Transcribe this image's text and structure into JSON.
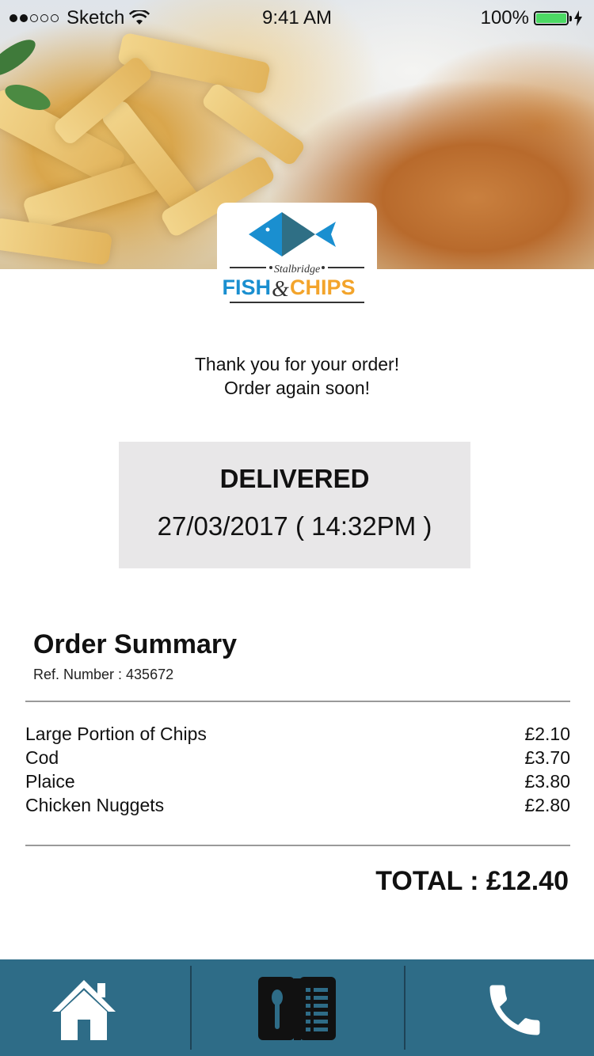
{
  "status_bar": {
    "carrier": "Sketch",
    "time": "9:41 AM",
    "battery": "100%"
  },
  "logo": {
    "script": "Stalbridge",
    "brand_left": "FISH",
    "amp": "&",
    "brand_right": "CHIPS"
  },
  "message": {
    "line1": "Thank you for your order!",
    "line2": "Order again soon!"
  },
  "order_status": {
    "state": "DELIVERED",
    "datetime": "27/03/2017 ( 14:32PM )"
  },
  "summary": {
    "title": "Order Summary",
    "ref": "Ref. Number : 435672",
    "items": [
      {
        "name": "Large Portion of Chips",
        "price": "£2.10"
      },
      {
        "name": "Cod",
        "price": "£3.70"
      },
      {
        "name": "Plaice",
        "price": "£3.80"
      },
      {
        "name": "Chicken Nuggets",
        "price": "£2.80"
      }
    ],
    "total": "TOTAL : £12.40"
  },
  "tabs": [
    {
      "icon": "home-icon"
    },
    {
      "icon": "menu-icon"
    },
    {
      "icon": "phone-icon"
    }
  ],
  "colors": {
    "tab_bar": "#2e6c87",
    "fish_light": "#1a8fd0",
    "fish_dark": "#2f6f85",
    "chips_orange": "#f3a42b",
    "battery_green": "#4cd964"
  }
}
